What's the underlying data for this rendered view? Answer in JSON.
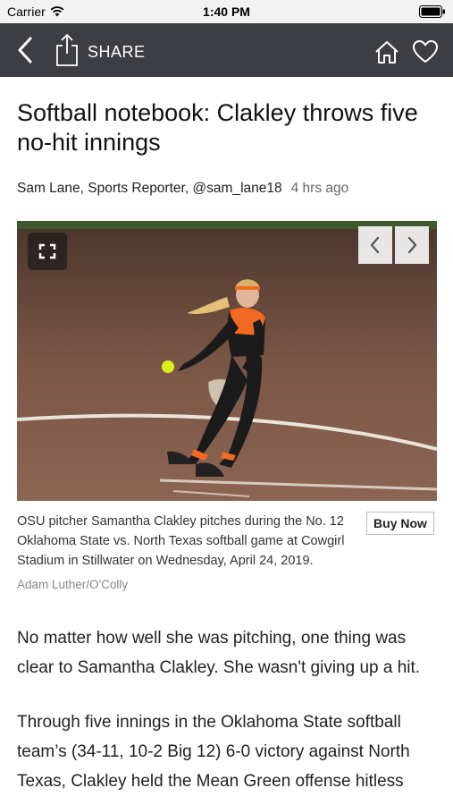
{
  "status_bar": {
    "carrier": "Carrier",
    "time": "1:40 PM"
  },
  "nav": {
    "share_label": "SHARE",
    "icons": {
      "back": "chevron-left-icon",
      "share": "share-icon",
      "home": "home-icon",
      "favorite": "heart-icon"
    },
    "background": "#3d3e43"
  },
  "article": {
    "headline": "Softball notebook: Clakley throws five no-hit innings",
    "byline": "Sam Lane, Sports Reporter, @sam_lane18",
    "age": "4 hrs ago",
    "photo": {
      "caption": "OSU pitcher Samantha Clakley pitches during the No. 12 Oklahoma State vs. North Texas softball game at Cowgirl Stadium in Stillwater on Wednesday, April 24, 2019.",
      "credit": "Adam Luther/O'Colly",
      "buy_label": "Buy Now"
    },
    "paragraphs": [
      "No matter how well she was pitching, one thing was clear to Samantha Clakley. She wasn't giving up a hit.",
      "Through five innings in the Oklahoma State softball team’s (34-11, 10-2 Big 12) 6-0 victory against North Texas, Clakley held the Mean Green offense hitless"
    ]
  }
}
